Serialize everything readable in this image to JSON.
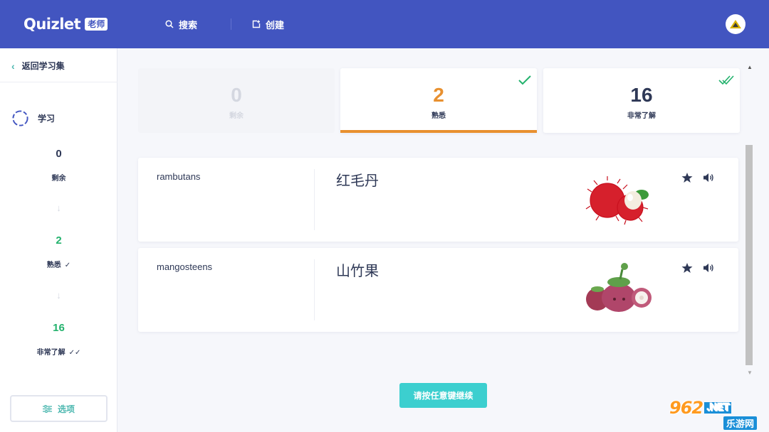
{
  "header": {
    "logo": "Quizlet",
    "logo_badge": "老师",
    "search_label": "搜索",
    "create_label": "创建"
  },
  "sidebar": {
    "back_label": "返回学习集",
    "mode_label": "学习",
    "stats": [
      {
        "num": "0",
        "label": "剩余",
        "color": "#2e3856"
      },
      {
        "num": "2",
        "label": "熟悉",
        "color": "#23b26d",
        "tick": "✓"
      },
      {
        "num": "16",
        "label": "非常了解",
        "color": "#23b26d",
        "tick": "✓✓"
      }
    ],
    "options_label": "选项"
  },
  "scores": [
    {
      "num": "0",
      "label": "剩余",
      "state": "dim"
    },
    {
      "num": "2",
      "label": "熟悉",
      "state": "active",
      "accent": "#e8902f"
    },
    {
      "num": "16",
      "label": "非常了解",
      "state": "normal"
    }
  ],
  "terms": [
    {
      "word": "rambutans",
      "definition": "红毛丹",
      "image": "rambutan-image"
    },
    {
      "word": "mangosteens",
      "definition": "山竹果",
      "image": "mangosteen-image"
    }
  ],
  "continue_label": "请按任意键继续",
  "watermark": {
    "top": "962",
    "net": ".NET",
    "bottom": "乐游网"
  },
  "colors": {
    "header": "#4255c0",
    "accent_teal": "#4db8b0",
    "continue": "#3ccfcf",
    "check_green": "#23b26d"
  }
}
